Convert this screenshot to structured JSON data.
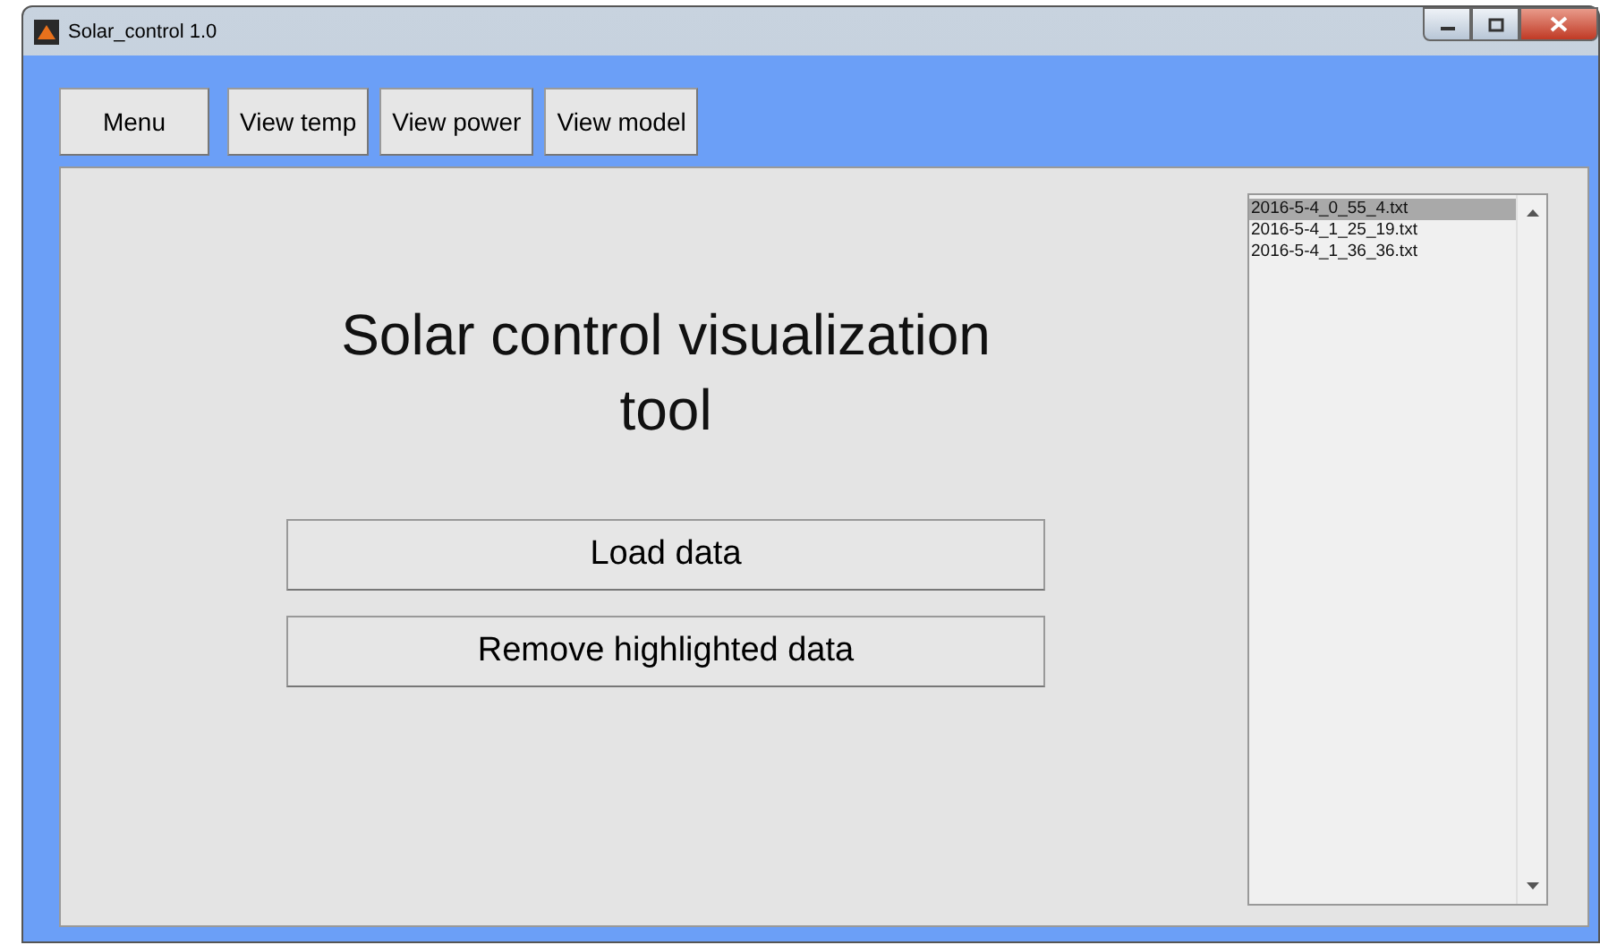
{
  "window": {
    "title": "Solar_control 1.0"
  },
  "toolbar": [
    "Menu",
    "View temp",
    "View power",
    "View model"
  ],
  "heading": "Solar control visualization tool",
  "actions": [
    "Load data",
    "Remove highlighted data"
  ],
  "files": [
    {
      "name": "2016-5-4_0_55_4.txt",
      "selected": true
    },
    {
      "name": "2016-5-4_1_25_19.txt",
      "selected": false
    },
    {
      "name": "2016-5-4_1_36_36.txt",
      "selected": false
    }
  ]
}
